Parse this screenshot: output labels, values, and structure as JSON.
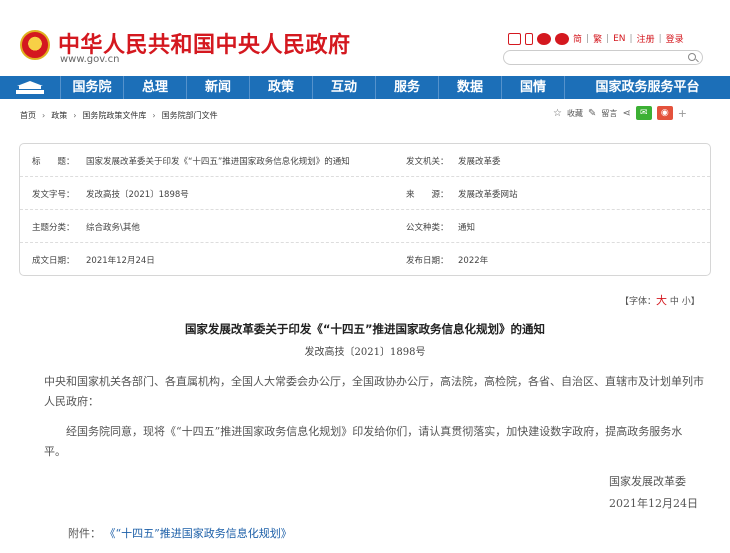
{
  "header": {
    "site_title": "中华人民共和国中央人民政府",
    "site_url": "www.gov.cn",
    "links": {
      "simplified": "简",
      "traditional": "繁",
      "english": "EN",
      "register": "注册",
      "login": "登录"
    },
    "search_placeholder": ""
  },
  "nav": {
    "items": [
      "国务院",
      "总理",
      "新闻",
      "政策",
      "互动",
      "服务",
      "数据",
      "国情",
      "国家政务服务平台"
    ]
  },
  "breadcrumb": [
    "首页",
    "政策",
    "国务院政策文件库",
    "国务院部门文件"
  ],
  "tools": {
    "favorite": "收藏",
    "message": "留言"
  },
  "meta": {
    "rows": [
      {
        "label": "标　　题：",
        "value": "国家发展改革委关于印发《“十四五”推进国家政务信息化规划》的通知",
        "label2": "发文机关：",
        "value2": "发展改革委"
      },
      {
        "label": "发文字号：",
        "value": "发改高技〔2021〕1898号",
        "label2": "来　　源：",
        "value2": "发展改革委网站"
      },
      {
        "label": "主题分类：",
        "value": "综合政务\\其他",
        "label2": "公文种类：",
        "value2": "通知"
      },
      {
        "label": "成文日期：",
        "value": "2021年12月24日",
        "label2": "发布日期：",
        "value2": "2022年"
      }
    ]
  },
  "fontsize": {
    "prefix": "【字体：",
    "large": "大",
    "medium": "中",
    "small": "小",
    "suffix": "】"
  },
  "article": {
    "title": "国家发展改革委关于印发《“十四五”推进国家政务信息化规划》的通知",
    "doc_no": "发改高技〔2021〕1898号",
    "para1": "中央和国家机关各部门、各直属机构，全国人大常委会办公厅，全国政协办公厅，高法院，高检院，各省、自治区、直辖市及计划单列市人民政府：",
    "para2": "经国务院同意，现将《“十四五”推进国家政务信息化规划》印发给你们，请认真贯彻落实，加快建设数字政府，提高政务服务水平。",
    "signer": "国家发展改革委",
    "date": "2021年12月24日",
    "attach_label": "附件：",
    "attach_link": "《“十四五”推进国家政务信息化规划》"
  }
}
